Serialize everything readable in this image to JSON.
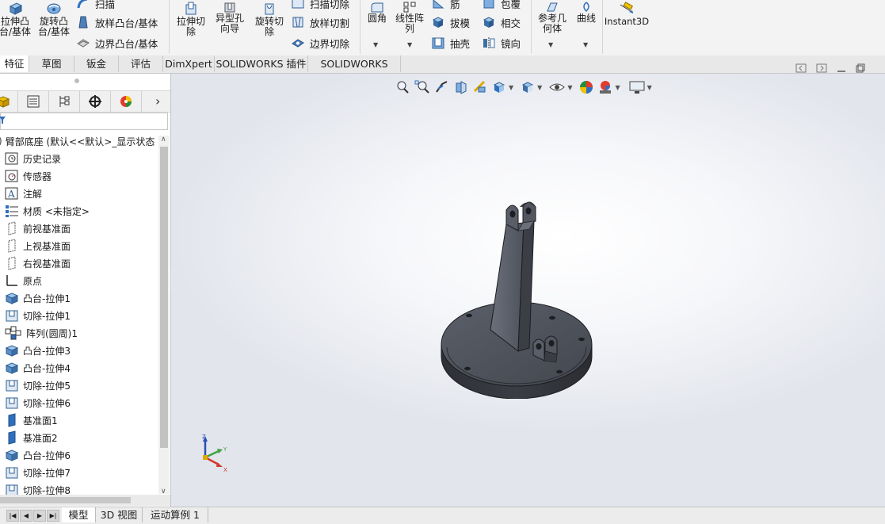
{
  "ribbon": {
    "extrude_boss_label": "拉伸凸\n台/基体",
    "revolve_boss_label": "旋转凸\n台/基体",
    "sweep_label": "扫描",
    "loft_boss_label": "放样凸台/基体",
    "boundary_boss_label": "边界凸台/基体",
    "extrude_cut_label": "拉伸切\n除",
    "hole_wizard_label": "异型孔\n向导",
    "revolve_cut_label": "旋转切\n除",
    "swept_cut_label": "扫描切除",
    "lofted_cut_label": "放样切割",
    "boundary_cut_label": "边界切除",
    "fillet_label": "圆角",
    "linear_pattern_label": "线性阵\n列",
    "rib_label": "筋",
    "draft_label": "拔模",
    "shell_label": "抽壳",
    "wrap_label": "包覆",
    "intersect_label": "相交",
    "mirror_label": "镜向",
    "ref_geometry_label": "参考几\n何体",
    "curves_label": "曲线",
    "instant3d_label": "Instant3D"
  },
  "tabs": [
    {
      "label": "特征",
      "active": true
    },
    {
      "label": "草图",
      "active": false
    },
    {
      "label": "钣金",
      "active": false
    },
    {
      "label": "评估",
      "active": false
    },
    {
      "label": "DimXpert",
      "active": false
    },
    {
      "label": "SOLIDWORKS 插件",
      "active": false
    },
    {
      "label": "SOLIDWORKS MBD",
      "active": false
    }
  ],
  "feature_tree": {
    "root_label": "臂部底座  (默认<<默认>_显示状态",
    "items": [
      {
        "label": "历史记录",
        "icon": "history-icon"
      },
      {
        "label": "传感器",
        "icon": "sensor-icon"
      },
      {
        "label": "注解",
        "icon": "annotation-icon"
      },
      {
        "label": "材质 <未指定>",
        "icon": "material-icon"
      },
      {
        "label": "前视基准面",
        "icon": "plane-icon"
      },
      {
        "label": "上视基准面",
        "icon": "plane-icon"
      },
      {
        "label": "右视基准面",
        "icon": "plane-icon"
      },
      {
        "label": "原点",
        "icon": "origin-icon"
      },
      {
        "label": "凸台-拉伸1",
        "icon": "boss-extrude-icon"
      },
      {
        "label": "切除-拉伸1",
        "icon": "cut-extrude-icon"
      },
      {
        "label": "阵列(圆周)1",
        "icon": "circular-pattern-icon"
      },
      {
        "label": "凸台-拉伸3",
        "icon": "boss-extrude-icon"
      },
      {
        "label": "凸台-拉伸4",
        "icon": "boss-extrude-icon"
      },
      {
        "label": "切除-拉伸5",
        "icon": "cut-extrude-icon"
      },
      {
        "label": "切除-拉伸6",
        "icon": "cut-extrude-icon"
      },
      {
        "label": "基准面1",
        "icon": "ref-plane-icon"
      },
      {
        "label": "基准面2",
        "icon": "ref-plane-icon"
      },
      {
        "label": "凸台-拉伸6",
        "icon": "boss-extrude-icon"
      },
      {
        "label": "切除-拉伸7",
        "icon": "cut-extrude-icon"
      },
      {
        "label": "切除-拉伸8",
        "icon": "cut-extrude-icon"
      }
    ]
  },
  "bottom_tabs": [
    {
      "label": "模型",
      "active": true
    },
    {
      "label": "3D 视图",
      "active": false
    },
    {
      "label": "运动算例 1",
      "active": false
    }
  ],
  "triad": {
    "x": "X",
    "y": "Y",
    "z": "Z"
  },
  "colors": {
    "accent": "#2f6fc0",
    "model": "#4a4e58",
    "axis_x": "#d23a2c",
    "axis_y": "#3fa33f",
    "axis_z": "#2d4fb8"
  }
}
